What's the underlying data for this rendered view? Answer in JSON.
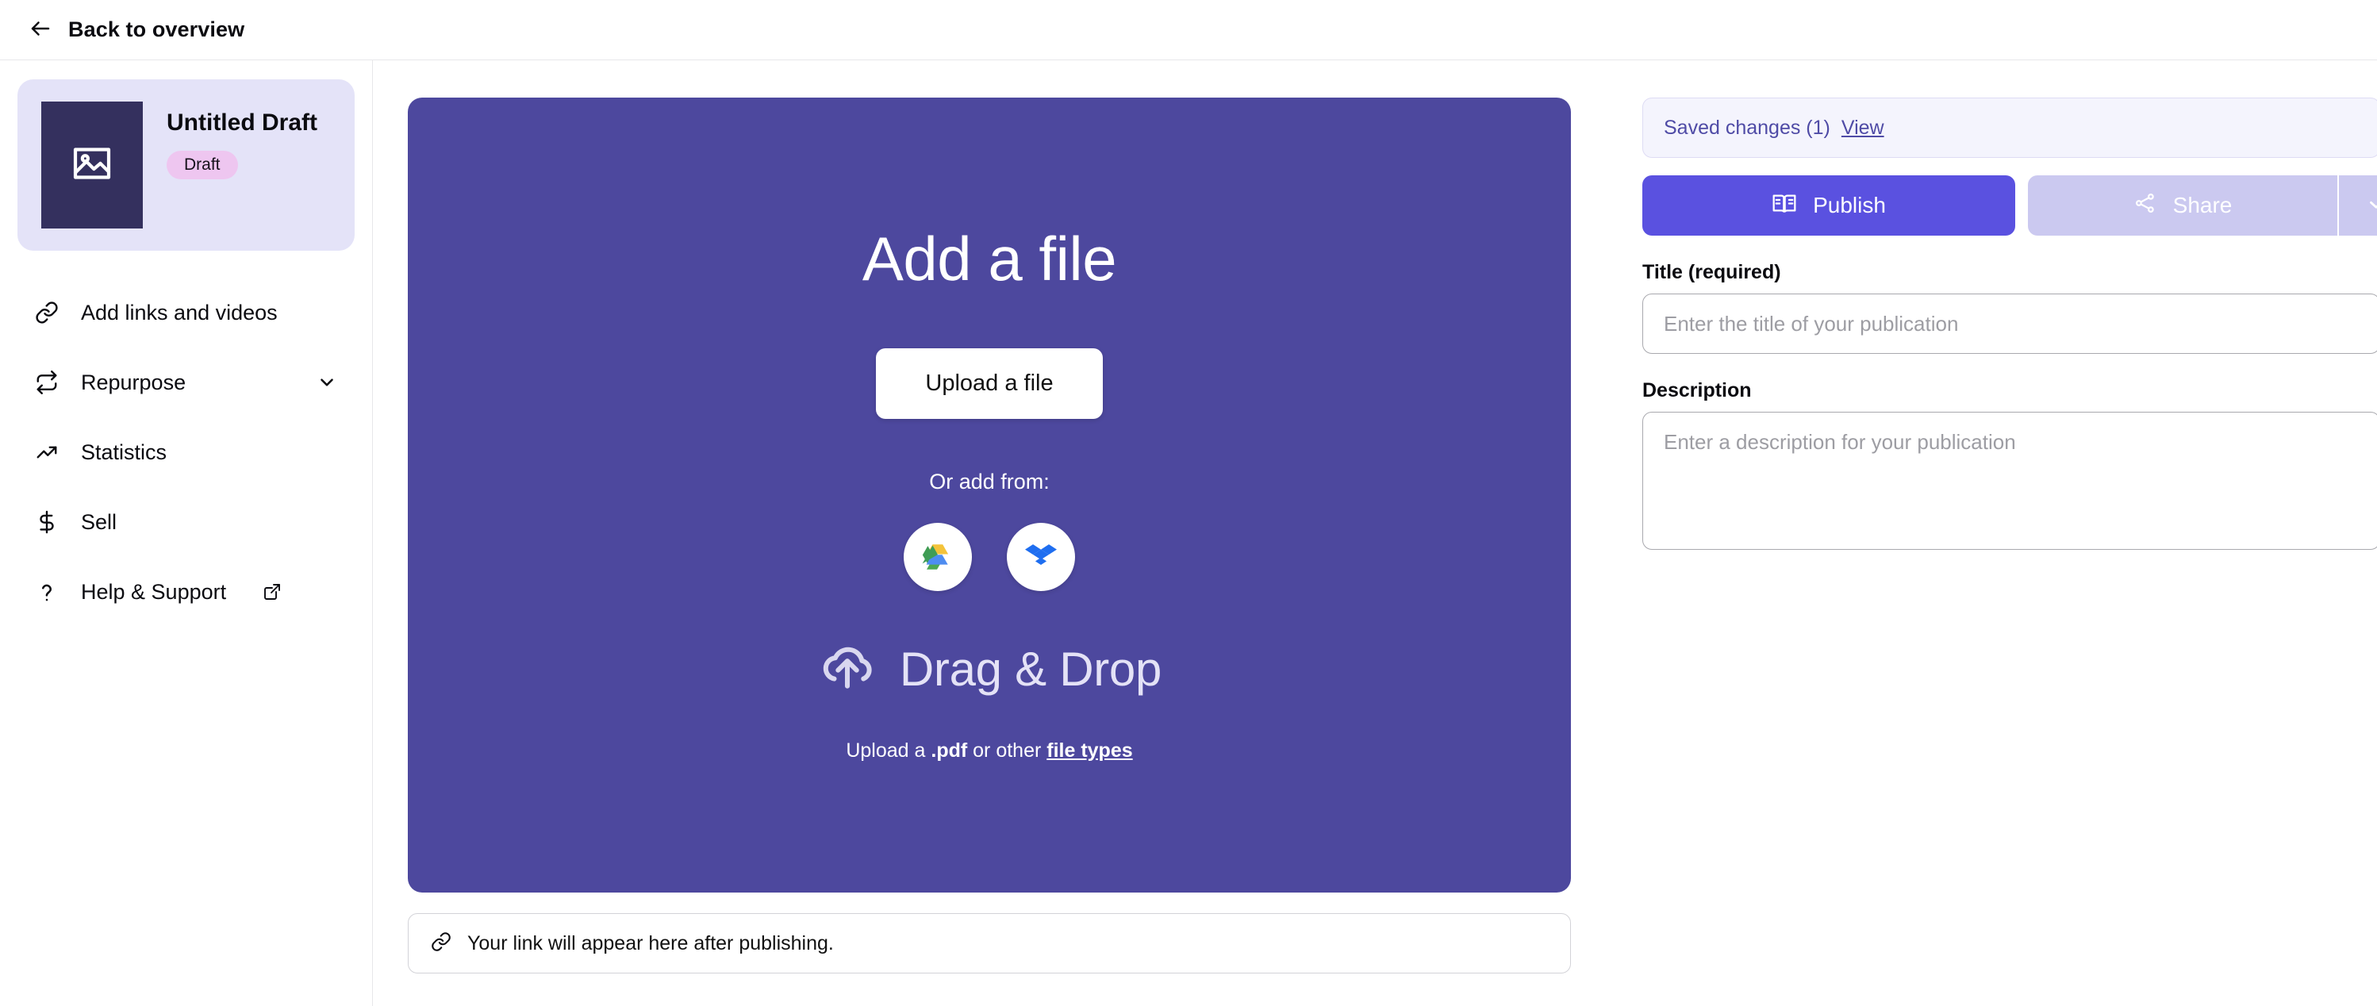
{
  "header": {
    "back_label": "Back to overview",
    "back_icon": "arrow-left-icon"
  },
  "sidebar": {
    "draft_card": {
      "title": "Untitled Draft",
      "badge": "Draft",
      "thumbnail_icon": "image-placeholder-icon",
      "thumbnail_color": "#34305e",
      "card_color": "#e4e3f8",
      "badge_color": "#eec6f0"
    },
    "items": [
      {
        "label": "Add links and videos",
        "icon": "link-icon",
        "trailing": "none"
      },
      {
        "label": "Repurpose",
        "icon": "repeat-icon",
        "trailing": "chevron-down-icon"
      },
      {
        "label": "Statistics",
        "icon": "trending-up-icon",
        "trailing": "none"
      },
      {
        "label": "Sell",
        "icon": "dollar-icon",
        "trailing": "none"
      },
      {
        "label": "Help & Support",
        "icon": "question-mark-icon",
        "trailing": "external-link-icon"
      }
    ]
  },
  "dropzone": {
    "title": "Add a file",
    "upload_button": "Upload a file",
    "or_add_from": "Or add from:",
    "providers": [
      {
        "name": "google-drive-icon",
        "label": "Google Drive"
      },
      {
        "name": "dropbox-icon",
        "label": "Dropbox"
      }
    ],
    "drag_drop_label": "Drag & Drop",
    "drag_drop_icon": "cloud-upload-icon",
    "hint_prefix": "Upload a ",
    "hint_bold": ".pdf",
    "hint_middle": " or other ",
    "hint_link": "file types",
    "background_color": "#4d489e"
  },
  "link_bar": {
    "text": "Your link will appear here after publishing.",
    "icon": "link-icon"
  },
  "right_panel": {
    "saved": {
      "text": "Saved changes (1)",
      "view_label": "View",
      "count": 1
    },
    "publish_button": {
      "label": "Publish",
      "icon": "open-book-icon",
      "color": "#5a51e0"
    },
    "share_button": {
      "label": "Share",
      "icon": "share-nodes-icon",
      "caret_icon": "chevron-down-icon",
      "color": "#cbc9f0",
      "disabled": true
    },
    "title_field": {
      "label": "Title (required)",
      "placeholder": "Enter the title of your publication",
      "value": ""
    },
    "description_field": {
      "label": "Description",
      "placeholder": "Enter a description for your publication",
      "value": ""
    }
  }
}
